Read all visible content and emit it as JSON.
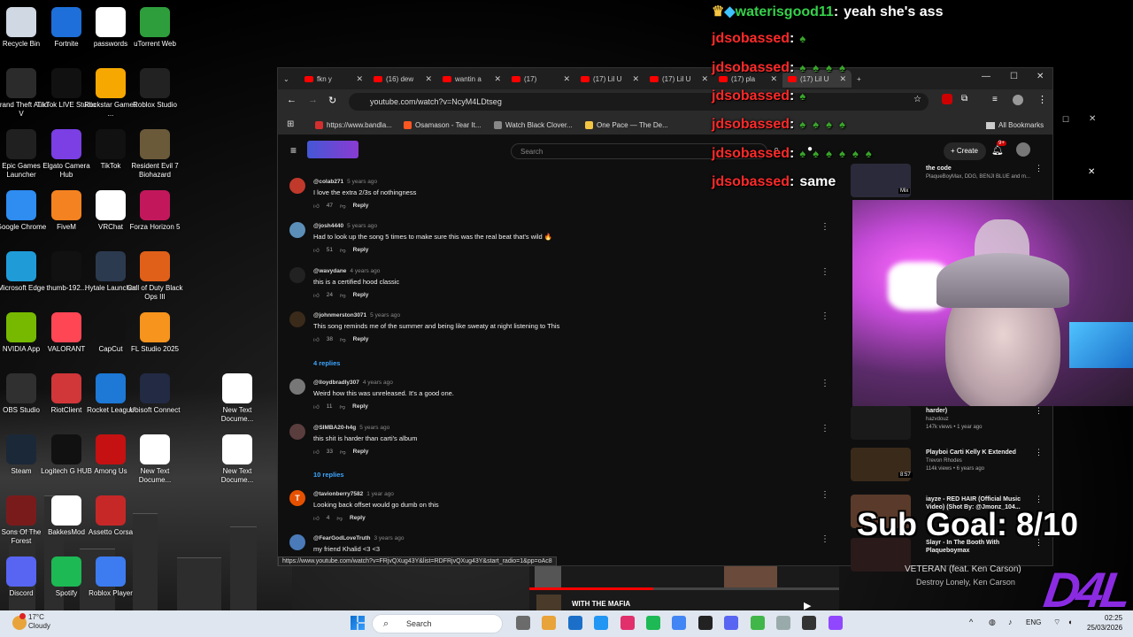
{
  "desktop": {
    "icons": [
      {
        "label": "Recycle Bin",
        "color": "#cfd8e3"
      },
      {
        "label": "Fortnite",
        "color": "#1e6fd9"
      },
      {
        "label": "passwords",
        "color": "#ffffff"
      },
      {
        "label": "uTorrent Web",
        "color": "#2e9e3c"
      },
      {
        "label": "Grand Theft Auto V",
        "color": "#2b2b2b"
      },
      {
        "label": "TikTok LIVE Studio",
        "color": "#111111"
      },
      {
        "label": "Rockstar Games ...",
        "color": "#f6a800"
      },
      {
        "label": "Roblox Studio",
        "color": "#222222"
      },
      {
        "label": "Epic Games Launcher",
        "color": "#202020"
      },
      {
        "label": "Elgato Camera Hub",
        "color": "#7b3fe4"
      },
      {
        "label": "TikTok",
        "color": "#111111"
      },
      {
        "label": "Resident Evil 7 Biohazard",
        "color": "#6b5a3a"
      },
      {
        "label": "Google Chrome",
        "color": "#2f8cf0"
      },
      {
        "label": "FiveM",
        "color": "#f58220"
      },
      {
        "label": "VRChat",
        "color": "#ffffff"
      },
      {
        "label": "Forza Horizon 5",
        "color": "#c2185b"
      },
      {
        "label": "Microsoft Edge",
        "color": "#1f9cd8"
      },
      {
        "label": "thumb-192...",
        "color": "#111111"
      },
      {
        "label": "Hytale Launcher",
        "color": "#2c3a4f"
      },
      {
        "label": "Call of Duty Black Ops III",
        "color": "#e0601a"
      },
      {
        "label": "NVIDIA App",
        "color": "#76b900"
      },
      {
        "label": "VALORANT",
        "color": "#ff4655"
      },
      {
        "label": "CapCut",
        "color": "#111111"
      },
      {
        "label": "FL Studio 2025",
        "color": "#f7941d"
      },
      {
        "label": "OBS Studio",
        "color": "#303030"
      },
      {
        "label": "RiotClient",
        "color": "#d13639"
      },
      {
        "label": "Rocket League",
        "color": "#1d78d6"
      },
      {
        "label": "Ubisoft Connect",
        "color": "#222a44"
      },
      {
        "label": "Steam",
        "color": "#1b2838"
      },
      {
        "label": "Logitech G HUB",
        "color": "#111111"
      },
      {
        "label": "Among Us",
        "color": "#c51111"
      },
      {
        "label": "New Text Docume...",
        "color": "#ffffff"
      },
      {
        "label": "Sons Of The Forest",
        "color": "#7a1b1b"
      },
      {
        "label": "BakkesMod",
        "color": "#ffffff"
      },
      {
        "label": "Assetto Corsa",
        "color": "#c62828"
      },
      {
        "label": "New Text Docume...",
        "color": "#ffffff"
      },
      {
        "label": "Discord",
        "color": "#5865f2"
      },
      {
        "label": "Spotify",
        "color": "#1db954"
      },
      {
        "label": "Roblox Player",
        "color": "#3d7bf0"
      },
      {
        "label": "New Text Docume...",
        "color": "#ffffff"
      }
    ]
  },
  "browser": {
    "tabs": [
      {
        "label": "fkn y"
      },
      {
        "label": "(16) dew"
      },
      {
        "label": "wantin a"
      },
      {
        "label": "(17)"
      },
      {
        "label": "(17) Lil U"
      },
      {
        "label": "(17) Lil U"
      },
      {
        "label": "(17) pla"
      },
      {
        "label": "(17) Lil U"
      }
    ],
    "new_tab": "+",
    "url": "youtube.com/watch?v=NcyM4LDtseg",
    "bookmarks": [
      {
        "label": "https://www.bandla...",
        "color": "#d32f2f"
      },
      {
        "label": "Osamason - Tear It...",
        "color": "#ff5722"
      },
      {
        "label": "Watch Black Clover...",
        "color": "#888888"
      },
      {
        "label": "One Pace — The De...",
        "color": "#f4c542"
      }
    ],
    "all_bookmarks": "All Bookmarks",
    "status_url": "https://www.youtube.com/watch?v=FRjvQXug43Y&list=RDFRjvQXug43Y&start_radio=1&pp=oAc8"
  },
  "youtube": {
    "search_placeholder": "Search",
    "create_label": "Create",
    "notif_badge": "9+",
    "comments": [
      {
        "user": "@colab271",
        "time": "5 years ago",
        "text": "I love the extra 2/3s of nothingness",
        "likes": "47",
        "avatar": "#c0392b"
      },
      {
        "user": "@josh4440",
        "time": "5 years ago",
        "text": "Had to look up the song 5 times to make sure this was the real beat that's wild 🔥",
        "likes": "51",
        "avatar": "#5c8fb8"
      },
      {
        "user": "@wavydane",
        "time": "4 years ago",
        "text": "this is a certified hood classic",
        "likes": "24",
        "avatar": "#222222"
      },
      {
        "user": "@johnmerston3071",
        "time": "5 years ago",
        "text": "This song reminds me of the summer and being like sweaty at night listening to This",
        "likes": "38",
        "avatar": "#3a2a1a"
      },
      {
        "user": "@lloydbradly307",
        "time": "4 years ago",
        "text": "Weird how this was unreleased. It's a good one.",
        "likes": "11",
        "avatar": "#777777"
      },
      {
        "user": "@SIMBA20-h4g",
        "time": "5 years ago",
        "text": "this shit is harder than carti's album",
        "likes": "33",
        "avatar": "#5a3d3d"
      },
      {
        "user": "@tavionberry7582",
        "time": "1 year ago",
        "text": "Looking back offset would go dumb on this",
        "likes": "4",
        "avatar": "#e65100",
        "initial": "T"
      },
      {
        "user": "@FearGodLoveTruth",
        "time": "3 years ago",
        "text": "my friend Khalid <3 <3",
        "likes": "",
        "avatar": "#4a7ab8"
      }
    ],
    "replies_a": "4 replies",
    "replies_b": "10 replies",
    "reply_label": "Reply",
    "sidebar": [
      {
        "title": "the code",
        "meta": "PlaqueBoyMax, DDG, BENJI BLUE and m...",
        "badge": "Mix",
        "color": "#2a2a3a"
      },
      {
        "title": "harder)",
        "meta": "hazvdouz",
        "meta2": "147k views • 1 year ago",
        "color": "#1a1a1a"
      },
      {
        "title": "Playboi Carti Kelly K Extended",
        "meta": "Trevon Rhodes",
        "meta2": "114k views • 6 years ago",
        "duration": "8:57",
        "color": "#3a2a1a"
      },
      {
        "title": "iayze - RED HAIR (Official Music Video) (Shot By: @Jmonz_104...",
        "meta": "",
        "color": "#5a3a2a"
      },
      {
        "title": "Slayr - In The Booth With Plaqueboymax",
        "meta": "",
        "color": "#2a1a1a"
      }
    ],
    "mini_player": {
      "title": "WITH THE MAFIA",
      "next_title": "VETERAN (feat. Ken Carson)",
      "next_artist": "Destroy Lonely, Ken Carson"
    }
  },
  "stream": {
    "chat": [
      {
        "user": "waterisgood11",
        "message": "yeah she's ass"
      },
      {
        "user": "jdsobassed",
        "message": ""
      },
      {
        "user": "jdsobassed",
        "message": ""
      },
      {
        "user": "jdsobassed",
        "message": ""
      },
      {
        "user": "jdsobassed",
        "message": ""
      },
      {
        "user": "jdsobassed",
        "message": ""
      },
      {
        "user": "jdsobassed",
        "message": "same"
      }
    ],
    "sub_goal": "Sub Goal: 8/10",
    "logo": "D4L"
  },
  "taskbar": {
    "weather_temp": "17°C",
    "weather_desc": "Cloudy",
    "search": "Search",
    "lang": "ENG",
    "time": "02:25",
    "date": "25/03/2026"
  }
}
